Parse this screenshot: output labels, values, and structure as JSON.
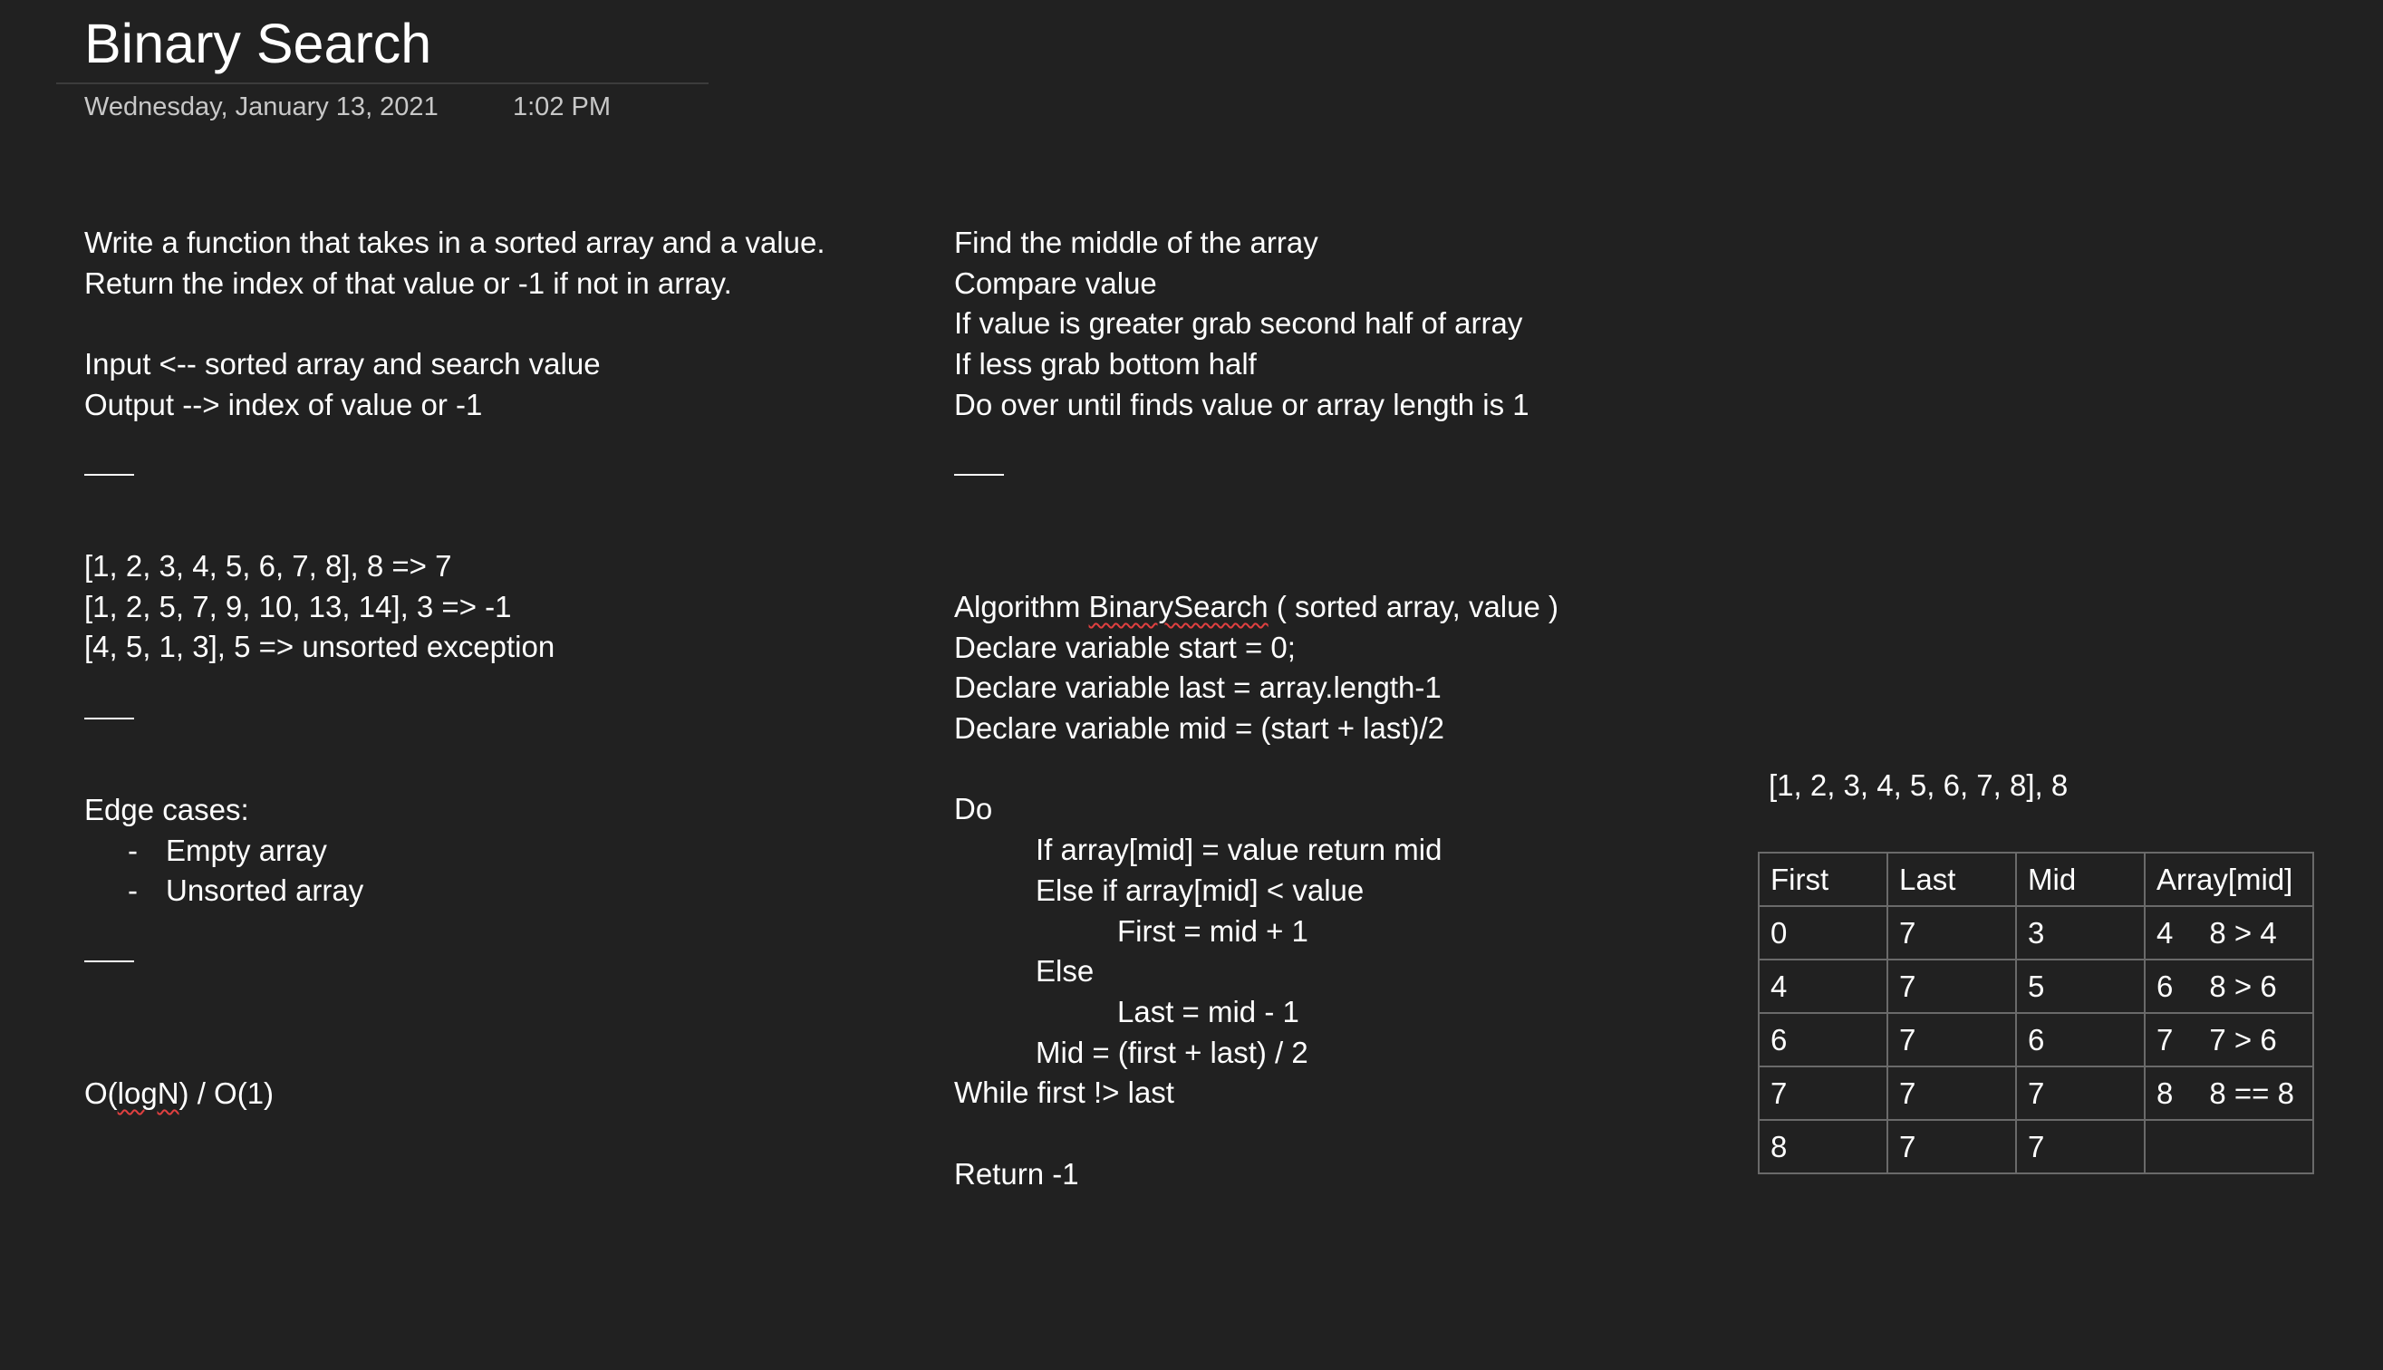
{
  "page": {
    "title": "Binary Search",
    "date": "Wednesday, January 13, 2021",
    "time": "1:02 PM"
  },
  "left": {
    "description": [
      "Write a function that takes in a sorted array and a value.",
      "Return the index of that value or -1 if not in array."
    ],
    "io": [
      "Input <-- sorted array and search value",
      "Output --> index of value or -1"
    ],
    "examples": [
      "[1, 2, 3, 4, 5, 6, 7, 8], 8  => 7",
      "[1, 2, 5, 7, 9, 10, 13, 14], 3 => -1",
      "[4, 5, 1, 3], 5 => unsorted exception"
    ],
    "edge_title": "Edge cases:",
    "bullet_marker": "-",
    "edge_cases": [
      "Empty array",
      "Unsorted array"
    ],
    "complexity_pre": "O(",
    "complexity_word": "logN",
    "complexity_post": ") / O(1)"
  },
  "middle": {
    "approach": [
      "Find the middle of the array",
      "Compare value",
      "If value is greater grab second half of array",
      "If less grab bottom half",
      "Do over until finds value or array length is 1"
    ],
    "algo_pre": "Algorithm ",
    "algo_name": "BinarySearch",
    "algo_post": " ( sorted array, value )",
    "declarations": [
      "Declare variable start = 0;",
      "Declare variable last = array.length-1",
      "Declare variable mid = (start + last)/2"
    ],
    "loop": {
      "do": "Do",
      "if_line": "If array[mid] = value return mid",
      "elseif_line": "Else if array[mid] < value",
      "first_assign": "First = mid + 1",
      "else_line": "Else",
      "last_assign": "Last = mid - 1",
      "mid_assign": "Mid = (first + last) / 2",
      "while_line": "While first !> last"
    },
    "return_line": "Return -1"
  },
  "trace": {
    "label": "[1, 2, 3, 4, 5, 6, 7, 8],  8",
    "headers": [
      "First",
      "Last",
      "Mid",
      "Array[mid]"
    ],
    "rows": [
      {
        "first": "0",
        "last": "7",
        "mid": "3",
        "val": "4",
        "cmp": "8  >  4"
      },
      {
        "first": "4",
        "last": "7",
        "mid": "5",
        "val": "6",
        "cmp": "8  >  6"
      },
      {
        "first": "6",
        "last": "7",
        "mid": "6",
        "val": "7",
        "cmp": "7  >  6"
      },
      {
        "first": "7",
        "last": "7",
        "mid": "7",
        "val": "8",
        "cmp": "8 == 8"
      },
      {
        "first": "8",
        "last": "7",
        "mid": "7",
        "val": "",
        "cmp": ""
      }
    ]
  }
}
